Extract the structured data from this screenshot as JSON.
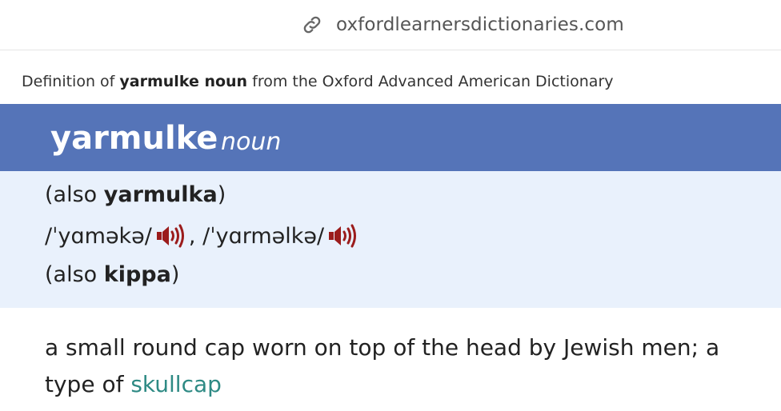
{
  "browser": {
    "url": "oxfordlearnersdictionaries.com"
  },
  "source": {
    "prefix": "Definition of",
    "term": "yarmulke noun",
    "suffix": "from the Oxford Advanced American Dictionary"
  },
  "entry": {
    "headword": "yarmulke",
    "pos": "noun",
    "variant1": {
      "open": "(also",
      "word": "yarmulka",
      "close": ")"
    },
    "pron1": "/ˈyɑməkə/",
    "separator": ",",
    "pron2": "/ˈyɑrməlkə/",
    "variant2": {
      "open": "(also",
      "word": "kippa",
      "close": ")"
    },
    "definition": "a small round cap worn on top of the head by Jewish men; a type of",
    "xref": "skullcap"
  },
  "colors": {
    "header_bg": "#5574b8",
    "variants_bg": "#e9f1fc",
    "speaker": "#9b1c1c",
    "xref_link": "#2e8a84"
  },
  "icons": [
    "link-icon",
    "speaker-icon"
  ]
}
